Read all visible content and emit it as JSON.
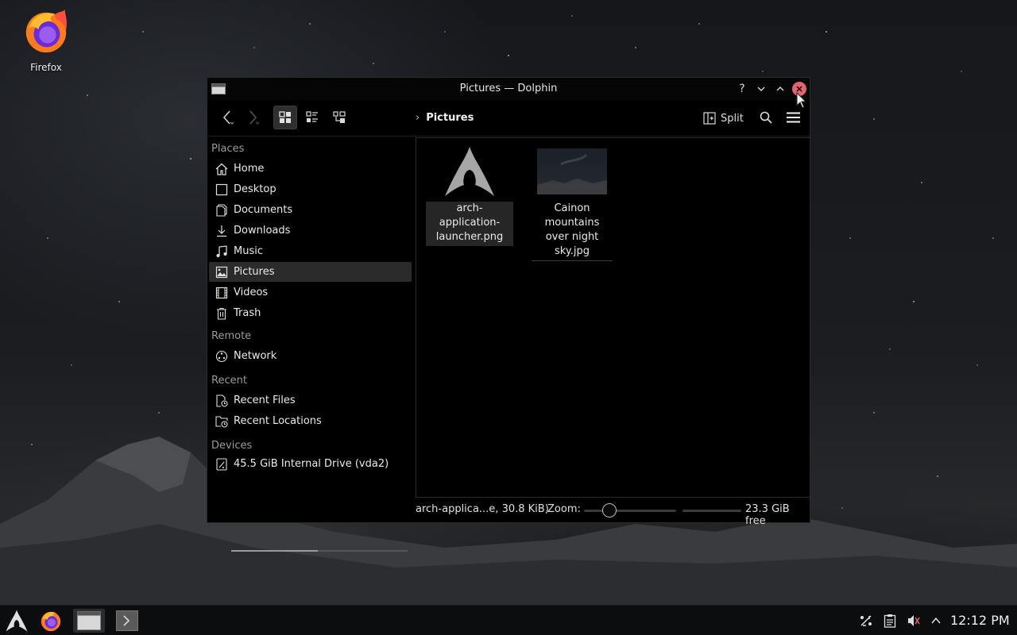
{
  "desktop": {
    "icons": [
      {
        "label": "Firefox",
        "icon": "firefox-icon"
      }
    ]
  },
  "window": {
    "title": "Pictures — Dolphin",
    "controls": {
      "help": "?",
      "minimize": "chevron-down-icon",
      "maximize": "chevron-up-icon",
      "close": "close-icon"
    },
    "toolbar": {
      "back": "arrow-left-icon",
      "forward": "arrow-right-icon",
      "view_modes": [
        "icons-view-icon",
        "compact-view-icon",
        "details-view-icon"
      ],
      "active_view": "icons",
      "breadcrumb": "Pictures",
      "split_label": "Split",
      "search": "search-icon",
      "menu": "hamburger-icon"
    },
    "sidebar": {
      "places_label": "Places",
      "places": [
        {
          "label": "Home",
          "icon": "home-icon"
        },
        {
          "label": "Desktop",
          "icon": "desktop-icon"
        },
        {
          "label": "Documents",
          "icon": "documents-icon"
        },
        {
          "label": "Downloads",
          "icon": "download-icon"
        },
        {
          "label": "Music",
          "icon": "music-icon"
        },
        {
          "label": "Pictures",
          "icon": "pictures-icon",
          "selected": true
        },
        {
          "label": "Videos",
          "icon": "videos-icon"
        },
        {
          "label": "Trash",
          "icon": "trash-icon"
        }
      ],
      "remote_label": "Remote",
      "remote": [
        {
          "label": "Network",
          "icon": "network-icon"
        }
      ],
      "recent_label": "Recent",
      "recent": [
        {
          "label": "Recent Files",
          "icon": "recent-files-icon"
        },
        {
          "label": "Recent Locations",
          "icon": "recent-locations-icon"
        }
      ],
      "devices_label": "Devices",
      "devices": [
        {
          "label": "45.5 GiB Internal Drive (vda2)",
          "icon": "drive-icon",
          "usage_fraction": 0.49
        }
      ]
    },
    "files": [
      {
        "name": "arch-application-\nlauncher.png",
        "line1": "arch-application-",
        "line2": "launcher.png",
        "selected": true
      },
      {
        "name": "Cainon mountains over night sky.jpg",
        "line1": "Cainon mountains",
        "line2": "over night sky.jpg",
        "selected": false
      }
    ],
    "status": {
      "selection": "arch-applica...e, 30.8 KiB)",
      "zoom_label": "Zoom:",
      "zoom_level": 0.28,
      "free_space": "23.3 GiB free"
    }
  },
  "taskbar": {
    "clock": "12:12 PM",
    "tray": [
      "network-icon",
      "clipboard-icon",
      "volume-muted-icon",
      "chevron-up-icon"
    ]
  },
  "colors": {
    "close_button": "#e2646f",
    "selection": "#2b2b2b"
  }
}
